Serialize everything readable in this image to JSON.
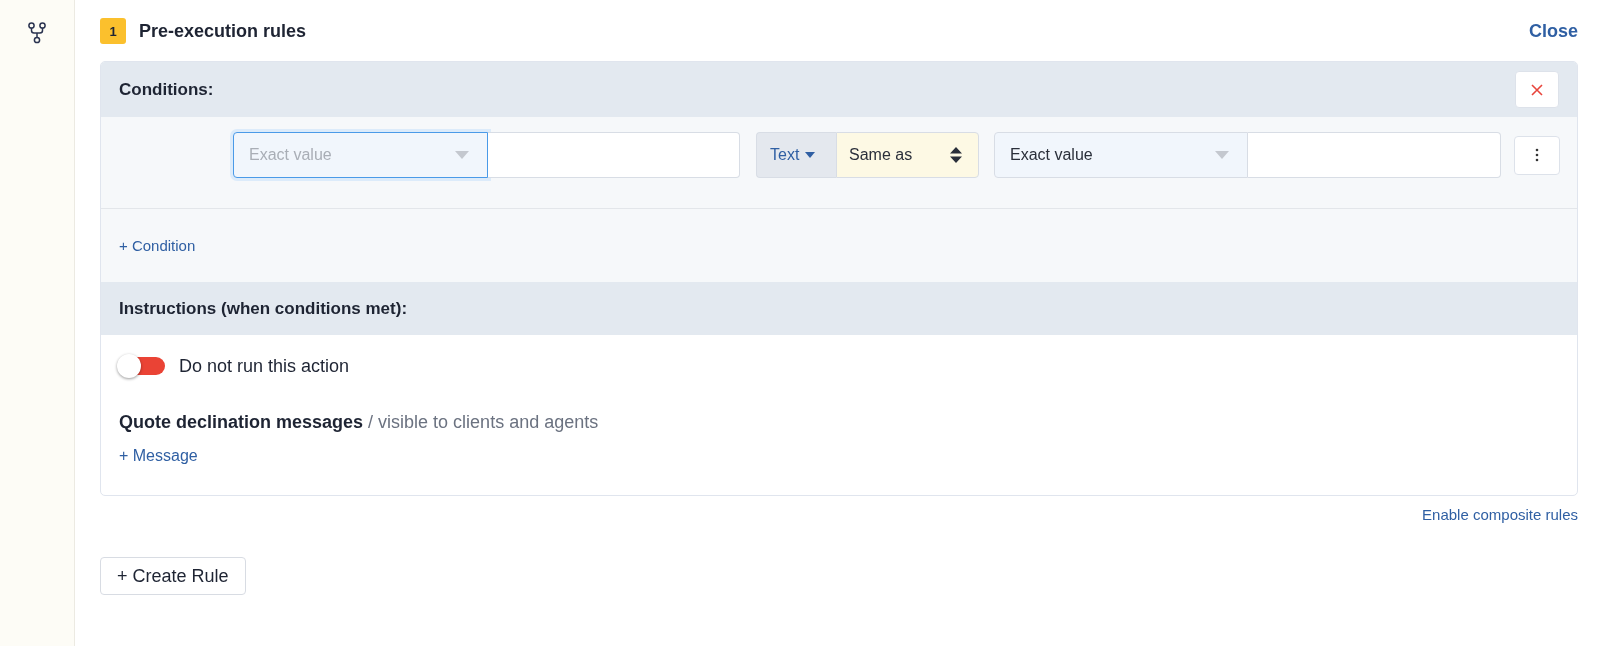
{
  "rule": {
    "number": "1",
    "title": "Pre-execution rules",
    "close": "Close"
  },
  "conditions": {
    "title": "Conditions:",
    "rows": [
      {
        "left_select": {
          "placeholder": "Exact value",
          "focused": true
        },
        "type": "Text",
        "operator": "Same as",
        "right_select": {
          "value": "Exact value"
        }
      }
    ],
    "add": "+ Condition"
  },
  "instructions": {
    "title": "Instructions (when conditions met):",
    "toggle": {
      "label": "Do not run this action",
      "on": false
    },
    "messages": {
      "title": "Quote declination messages",
      "note": "/ visible to clients and agents",
      "add": "+ Message"
    }
  },
  "enable_composite": "Enable composite rules",
  "create_rule": "+ Create Rule"
}
